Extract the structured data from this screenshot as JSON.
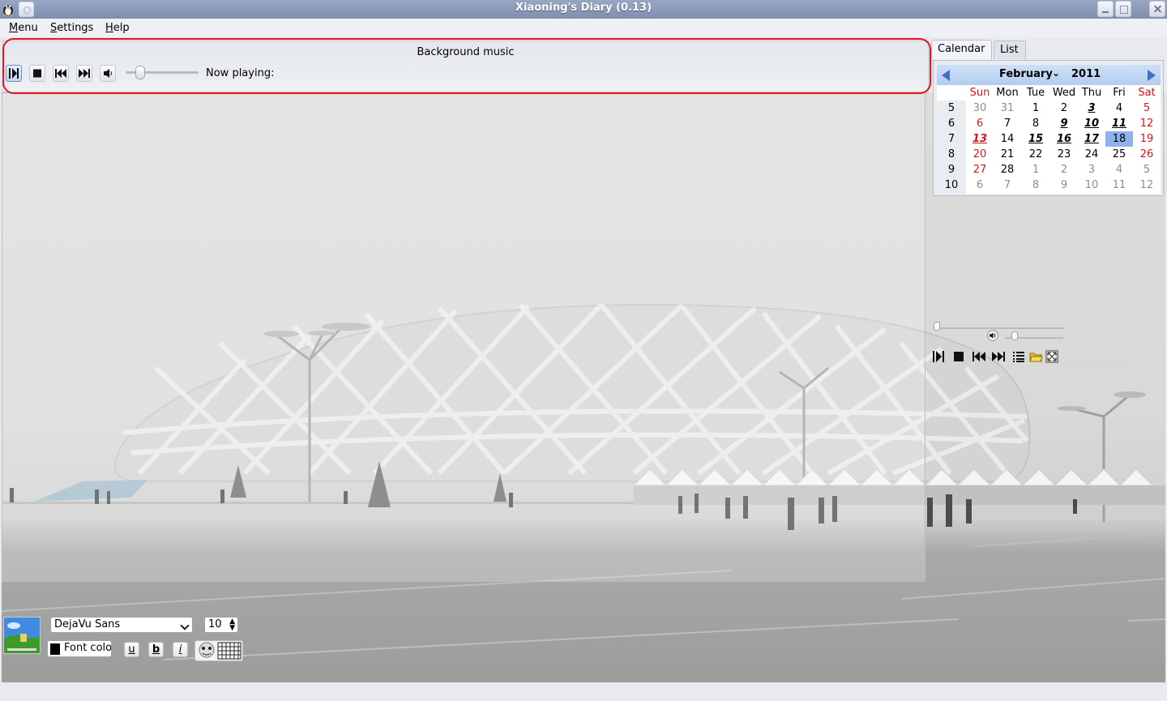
{
  "window": {
    "title": "Xiaoning's Diary (0.13)"
  },
  "menubar": {
    "items": [
      "Menu",
      "Settings",
      "Help"
    ]
  },
  "music": {
    "title": "Background music",
    "now_playing_label": "Now playing:",
    "volume": 0.2
  },
  "tabs": [
    "Calendar",
    "List"
  ],
  "calendar": {
    "month": "February",
    "chevron": "⌄",
    "year": "2011",
    "weekday_headers": [
      "Sun",
      "Mon",
      "Tue",
      "Wed",
      "Thu",
      "Fri",
      "Sat"
    ],
    "weeks": [
      {
        "week": "5",
        "days": [
          {
            "d": "30",
            "s": "other"
          },
          {
            "d": "31",
            "s": "other"
          },
          {
            "d": "1",
            "s": "cur"
          },
          {
            "d": "2",
            "s": "cur"
          },
          {
            "d": "3",
            "s": "cur bold"
          },
          {
            "d": "4",
            "s": "cur"
          },
          {
            "d": "5",
            "s": "red"
          }
        ]
      },
      {
        "week": "6",
        "days": [
          {
            "d": "6",
            "s": "red"
          },
          {
            "d": "7",
            "s": "cur"
          },
          {
            "d": "8",
            "s": "cur"
          },
          {
            "d": "9",
            "s": "cur bold"
          },
          {
            "d": "10",
            "s": "cur bold"
          },
          {
            "d": "11",
            "s": "cur bold"
          },
          {
            "d": "12",
            "s": "red"
          }
        ]
      },
      {
        "week": "7",
        "days": [
          {
            "d": "13",
            "s": "red bold"
          },
          {
            "d": "14",
            "s": "cur"
          },
          {
            "d": "15",
            "s": "cur bold"
          },
          {
            "d": "16",
            "s": "cur bold"
          },
          {
            "d": "17",
            "s": "cur bold"
          },
          {
            "d": "18",
            "s": "cur today"
          },
          {
            "d": "19",
            "s": "red"
          }
        ]
      },
      {
        "week": "8",
        "days": [
          {
            "d": "20",
            "s": "red"
          },
          {
            "d": "21",
            "s": "cur"
          },
          {
            "d": "22",
            "s": "cur"
          },
          {
            "d": "23",
            "s": "cur"
          },
          {
            "d": "24",
            "s": "cur"
          },
          {
            "d": "25",
            "s": "cur"
          },
          {
            "d": "26",
            "s": "red"
          }
        ]
      },
      {
        "week": "9",
        "days": [
          {
            "d": "27",
            "s": "red"
          },
          {
            "d": "28",
            "s": "cur"
          },
          {
            "d": "1",
            "s": "other"
          },
          {
            "d": "2",
            "s": "other"
          },
          {
            "d": "3",
            "s": "other"
          },
          {
            "d": "4",
            "s": "other"
          },
          {
            "d": "5",
            "s": "other"
          }
        ]
      },
      {
        "week": "10",
        "days": [
          {
            "d": "6",
            "s": "other"
          },
          {
            "d": "7",
            "s": "other"
          },
          {
            "d": "8",
            "s": "other"
          },
          {
            "d": "9",
            "s": "other"
          },
          {
            "d": "10",
            "s": "other"
          },
          {
            "d": "11",
            "s": "other"
          },
          {
            "d": "12",
            "s": "other"
          }
        ]
      }
    ]
  },
  "video_controls": {
    "icons": [
      "play-pause-icon",
      "stop-icon",
      "previous-icon",
      "next-icon",
      "playlist-icon",
      "open-folder-icon",
      "fullscreen-icon"
    ]
  },
  "format_toolbar": {
    "font_family": "DejaVu Sans",
    "font_size": "10",
    "font_color_label": "Font color",
    "underline_label": "u",
    "bold_label": "b",
    "italic_label": "i"
  },
  "colors": {
    "accent": "#3f6ec7",
    "highlight_ring": "#e8141c",
    "weekend": "#d0161c",
    "today": "#8cb4ea",
    "titlebar": "#8b98b7"
  }
}
